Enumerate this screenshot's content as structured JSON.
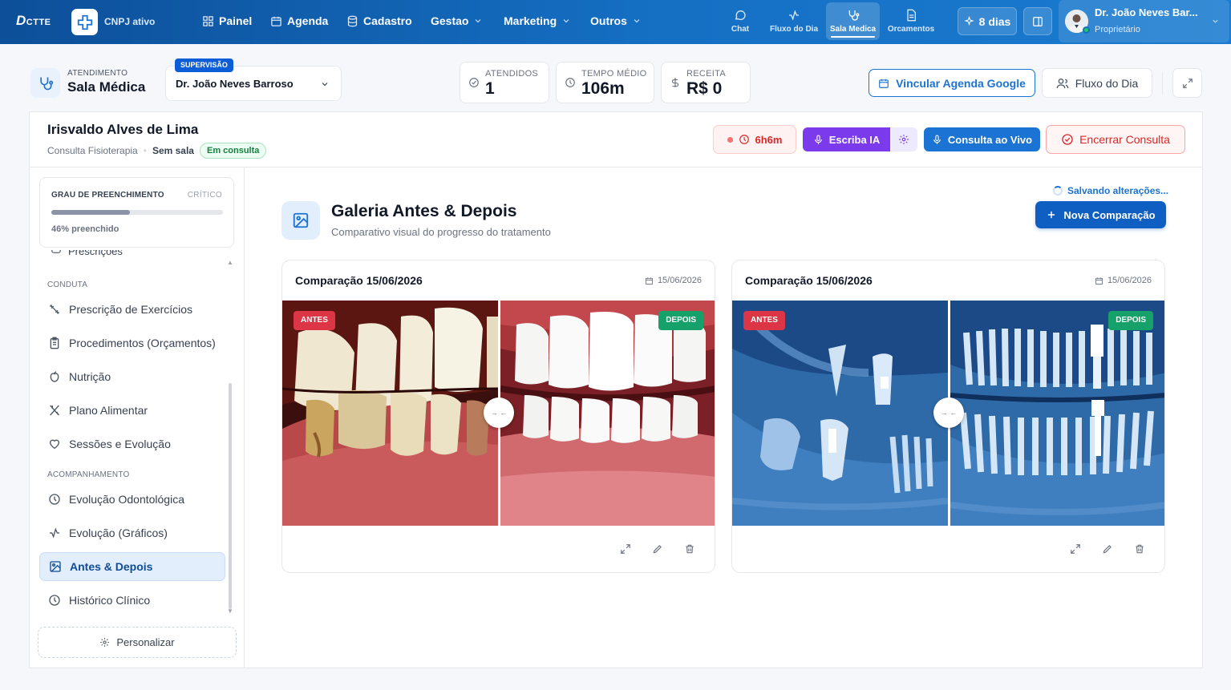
{
  "topbar": {
    "logo": "D",
    "logo_rest": "CTTE",
    "cnpj_status": "CNPJ ativo",
    "nav": [
      {
        "label": "Painel",
        "icon": "grid-icon"
      },
      {
        "label": "Agenda",
        "icon": "calendar-icon"
      },
      {
        "label": "Cadastro",
        "icon": "database-icon"
      },
      {
        "label": "Gestao",
        "icon": "chevron-down-icon"
      },
      {
        "label": "Marketing",
        "icon": "chevron-down-icon"
      },
      {
        "label": "Outros",
        "icon": "chevron-down-icon"
      }
    ],
    "quick": [
      {
        "label": "Chat",
        "icon": "chat-icon"
      },
      {
        "label": "Fluxo do Dia",
        "icon": "activity-icon"
      },
      {
        "label": "Sala Medica",
        "icon": "stethoscope-icon",
        "active": true
      },
      {
        "label": "Orcamentos",
        "icon": "file-icon"
      }
    ],
    "trial_days": "8 dias",
    "user_name": "Dr. João Neves Bar...",
    "user_role": "Proprietário"
  },
  "header": {
    "label": "ATENDIMENTO",
    "title": "Sala Médica",
    "supervision_tag": "SUPERVISÃO",
    "doctor_selected": "Dr. João Neves Barroso",
    "stats": [
      {
        "label": "ATENDIDOS",
        "value": "1",
        "icon": "check-circle-icon"
      },
      {
        "label": "TEMPO MÉDIO",
        "value": "106m",
        "icon": "clock-icon"
      },
      {
        "label": "RECEITA",
        "value": "R$ 0",
        "icon": "dollar-icon"
      }
    ],
    "google_button": "Vincular Agenda Google",
    "flow_button": "Fluxo do Dia"
  },
  "patient": {
    "name": "Irisvaldo Alves de Lima",
    "consult_type": "Consulta Fisioterapia",
    "room": "Sem sala",
    "status": "Em consulta",
    "timer": "6h6m",
    "scribe_button": "Escriba IA",
    "live_button": "Consulta ao Vivo",
    "end_button": "Encerrar Consulta"
  },
  "sidebar": {
    "fill_label": "GRAU DE PREENCHIMENTO",
    "fill_level_label": "CRÍTICO",
    "fill_percent": 46,
    "fill_text": "46% preenchido",
    "cut_item": "Prescrições",
    "section_conduta": "CONDUTA",
    "section_acompanhamento": "ACOMPANHAMENTO",
    "items": [
      {
        "label": "Prescrição de Exercícios",
        "icon": "dumbbell-icon"
      },
      {
        "label": "Procedimentos (Orçamentos)",
        "icon": "clipboard-icon"
      },
      {
        "label": "Nutrição",
        "icon": "apple-icon"
      },
      {
        "label": "Plano Alimentar",
        "icon": "utensils-icon"
      },
      {
        "label": "Sessões e Evolução",
        "icon": "heart-icon"
      },
      {
        "label": "Evolução Odontológica",
        "icon": "history-icon"
      },
      {
        "label": "Evolução (Gráficos)",
        "icon": "activity-icon"
      },
      {
        "label": "Antes & Depois",
        "icon": "image-icon",
        "active": true
      },
      {
        "label": "Histórico Clínico",
        "icon": "history-icon"
      }
    ],
    "customize_button": "Personalizar"
  },
  "gallery": {
    "title": "Galeria Antes & Depois",
    "subtitle": "Comparativo visual do progresso do tratamento",
    "saving_text": "Salvando alterações...",
    "new_button": "Nova Comparação",
    "before_tag": "ANTES",
    "after_tag": "DEPOIS",
    "cards": [
      {
        "title": "Comparação 15/06/2026",
        "date": "15/06/2026",
        "kind": "dental-photo"
      },
      {
        "title": "Comparação 15/06/2026",
        "date": "15/06/2026",
        "kind": "dental-xray"
      }
    ]
  },
  "colors": {
    "topbar": "#1570c4",
    "primary": "#1b73d3",
    "ia_purple": "#7c3aed",
    "danger": "#dc2626",
    "success": "#16a06a"
  }
}
